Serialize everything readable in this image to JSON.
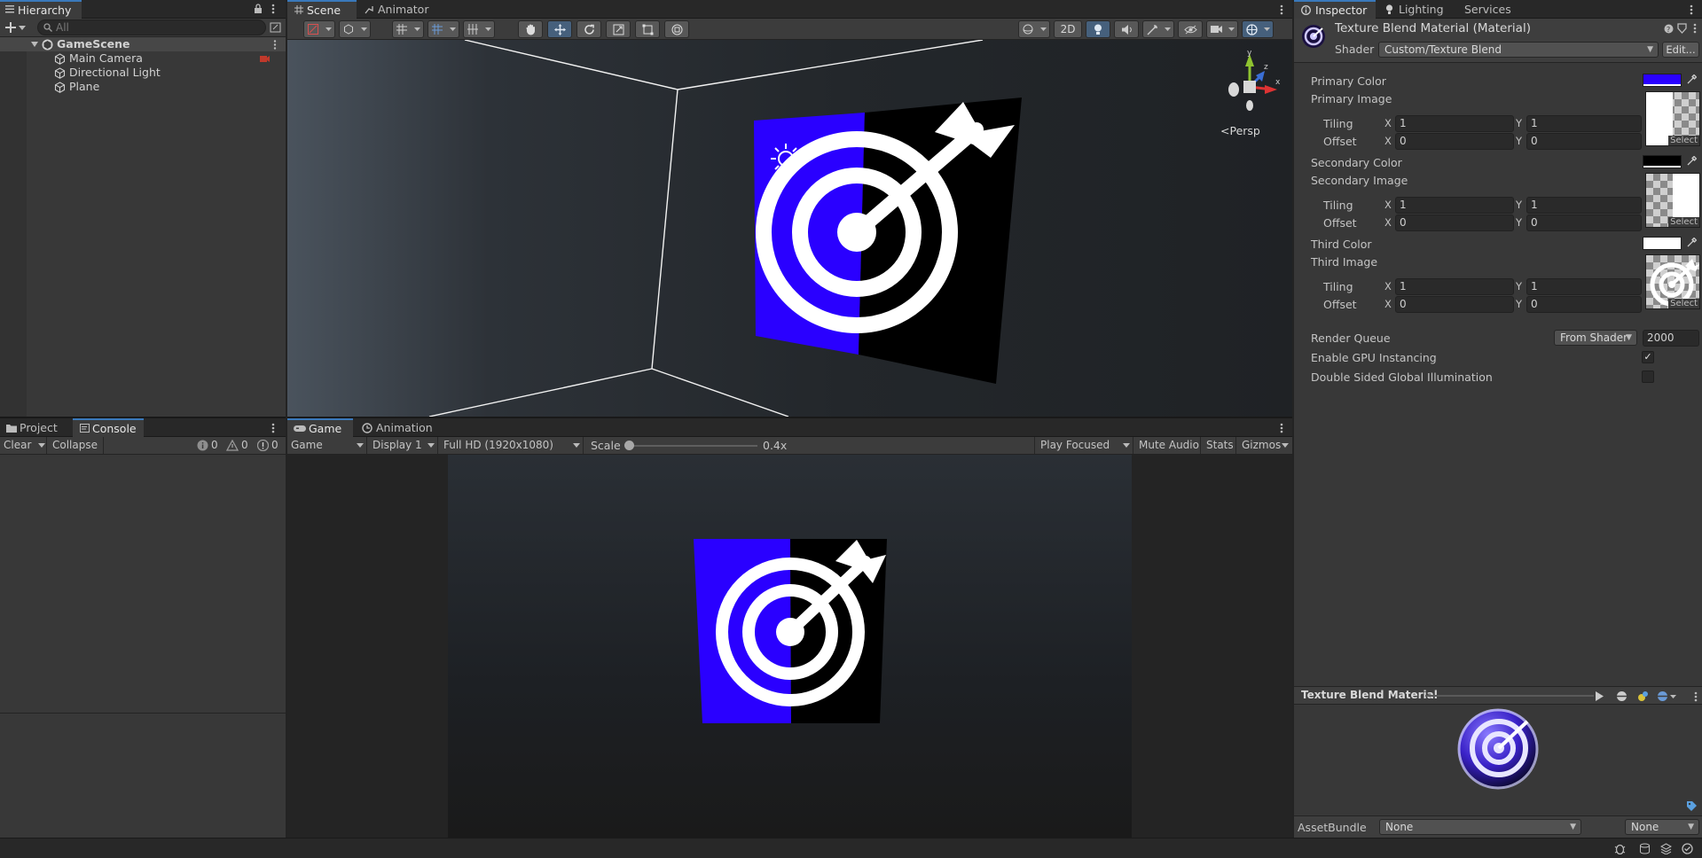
{
  "hierarchy": {
    "tab_label": "Hierarchy",
    "search_placeholder": "All",
    "scene_name": "GameScene",
    "items": [
      "Main Camera",
      "Directional Light",
      "Plane"
    ]
  },
  "scene_panel": {
    "tabs": [
      "Scene",
      "Animator"
    ],
    "toolbar": {
      "mode_2d": "2D"
    },
    "persp_label": "<Persp",
    "gizmo_axes": {
      "y": "y",
      "x": "x",
      "z": "z"
    }
  },
  "project_panel": {
    "tabs": [
      "Project",
      "Console"
    ],
    "clear_label": "Clear",
    "collapse_label": "Collapse",
    "log_count": "0",
    "warning_count": "0",
    "error_count": "0"
  },
  "game_panel": {
    "tabs": [
      "Game",
      "Animation"
    ],
    "view_select": "Game",
    "display_select": "Display 1",
    "resolution_select": "Full HD (1920x1080)",
    "scale_label": "Scale",
    "scale_value": "0.4x",
    "scale_fraction": 0.0,
    "play_focused": "Play Focused",
    "mute_audio": "Mute Audio",
    "stats": "Stats",
    "gizmos": "Gizmos"
  },
  "inspector": {
    "tabs": [
      "Inspector",
      "Lighting",
      "Services"
    ],
    "material_title": "Texture Blend Material (Material)",
    "shader_label": "Shader",
    "shader_value": "Custom/Texture Blend",
    "edit_button": "Edit...",
    "properties": [
      {
        "color_label": "Primary Color",
        "color_hex": "#2a00ff",
        "image_label": "Primary Image",
        "tiling_x": "1",
        "tiling_y": "1",
        "offset_x": "0",
        "offset_y": "0"
      },
      {
        "color_label": "Secondary Color",
        "color_hex": "#000000",
        "image_label": "Secondary Image",
        "tiling_x": "1",
        "tiling_y": "1",
        "offset_x": "0",
        "offset_y": "0"
      },
      {
        "color_label": "Third Color",
        "color_hex": "#ffffff",
        "image_label": "Third Image",
        "tiling_x": "1",
        "tiling_y": "1",
        "offset_x": "0",
        "offset_y": "0"
      }
    ],
    "tiling_label": "Tiling",
    "offset_label": "Offset",
    "x_label": "X",
    "y_label": "Y",
    "select_label": "Select",
    "render_queue_label": "Render Queue",
    "render_queue_mode": "From Shader",
    "render_queue_value": "2000",
    "gpu_instancing_label": "Enable GPU Instancing",
    "gpu_instancing_checked": true,
    "double_sided_label": "Double Sided Global Illumination",
    "double_sided_checked": false,
    "preview_title": "Texture Blend Material",
    "assetbundle_label": "AssetBundle",
    "assetbundle_name": "None",
    "assetbundle_variant": "None"
  },
  "colors": {
    "accent": "#3a79bb",
    "target_blue": "#2a00ff",
    "selected_tool": "#46607c"
  }
}
